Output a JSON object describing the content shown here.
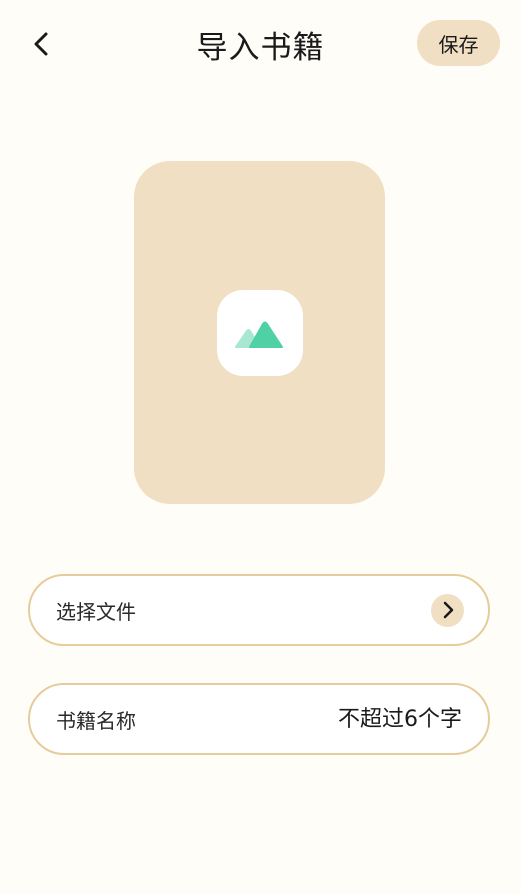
{
  "header": {
    "title": "导入书籍",
    "save_label": "保存"
  },
  "icons": {
    "back": "chevron-left-icon",
    "cover_placeholder": "mountain-image-icon",
    "file_arrow": "chevron-right-icon"
  },
  "form": {
    "select_file_label": "选择文件",
    "book_name_label": "书籍名称",
    "book_name_value": "",
    "book_name_placeholder": "不超过6个字"
  },
  "colors": {
    "background": "#FFFDF8",
    "accent": "#F0DFC2",
    "border": "#E6CC9C",
    "icon_green": "#4FD1A5",
    "icon_green_light": "#A8E8D2"
  }
}
